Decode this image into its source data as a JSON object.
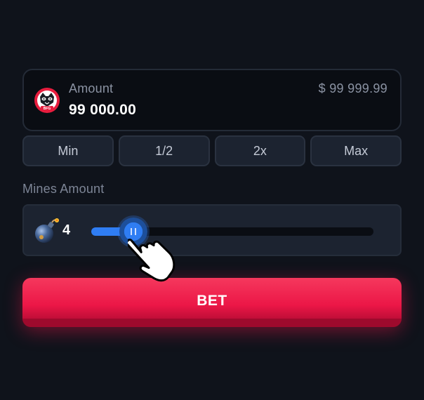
{
  "amount": {
    "label": "Amount",
    "value": "99 000.00",
    "balance": "$ 99 999.99",
    "token_icon": "bfg-token-icon"
  },
  "quick_bets": [
    {
      "label": "Min"
    },
    {
      "label": "1/2"
    },
    {
      "label": "2x"
    },
    {
      "label": "Max"
    }
  ],
  "mines": {
    "label": "Mines Amount",
    "count": "4",
    "icon": "bomb-icon",
    "slider_fraction": 0.15
  },
  "bet_button": {
    "label": "BET"
  },
  "colors": {
    "background": "#0f131b",
    "accent": "#2f7df3",
    "bet": "#ec1747",
    "panel": "#1c2330"
  }
}
